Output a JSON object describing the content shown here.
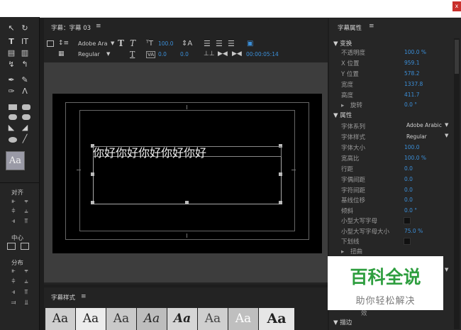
{
  "window": {
    "close_label": "x"
  },
  "title_editor": {
    "tab_label": "字幕：字幕 03",
    "font_family": "Adobe Ara",
    "font_style": "Regular",
    "font_size": "100.0",
    "kerning": "0.0",
    "leading": "0.0",
    "timecode": "00:00:05:14"
  },
  "canvas": {
    "text": "你好你好你好你好你好"
  },
  "left_panel": {
    "align_label": "对齐",
    "center_label": "中心",
    "distribute_label": "分布",
    "style_preview": "Aa"
  },
  "properties": {
    "panel_title": "字幕属性",
    "transform_group": "变换",
    "opacity": {
      "label": "不透明度",
      "value": "100.0 %"
    },
    "x_pos": {
      "label": "X 位置",
      "value": "959.1"
    },
    "y_pos": {
      "label": "Y 位置",
      "value": "578.2"
    },
    "width": {
      "label": "宽度",
      "value": "1337.8"
    },
    "height": {
      "label": "高度",
      "value": "411.7"
    },
    "rotation": {
      "label": "旋转",
      "value": "0.0 °"
    },
    "attributes_group": "属性",
    "font_family": {
      "label": "字体系列",
      "value": "Adobe Arabic"
    },
    "font_style": {
      "label": "字体样式",
      "value": "Regular"
    },
    "font_size": {
      "label": "字体大小",
      "value": "100.0"
    },
    "aspect": {
      "label": "宽高比",
      "value": "100.0 %"
    },
    "leading": {
      "label": "行距",
      "value": "0.0"
    },
    "kerning": {
      "label": "字偶间距",
      "value": "0.0"
    },
    "tracking": {
      "label": "字符间距",
      "value": "0.0"
    },
    "baseline": {
      "label": "基线位移",
      "value": "0.0"
    },
    "slant": {
      "label": "倾斜",
      "value": "0.0 °"
    },
    "small_caps": {
      "label": "小型大写字母"
    },
    "small_caps_size": {
      "label": "小型大写字母大小",
      "value": "75.0 %"
    },
    "underline": {
      "label": "下划线"
    },
    "distort": {
      "label": "扭曲"
    },
    "partial_label": "效",
    "stroke_group": "描边"
  },
  "styles_panel": {
    "title": "字幕样式",
    "swatches": [
      "Aa",
      "Aa",
      "Aa",
      "Aa",
      "Aa",
      "Aa",
      "Aa",
      "Aa"
    ]
  },
  "watermark": {
    "title": "百科全说",
    "subtitle": "助你轻松解决"
  },
  "colors": {
    "accent_blue": "#3b8fd9",
    "watermark_green": "#2e9e3f"
  }
}
